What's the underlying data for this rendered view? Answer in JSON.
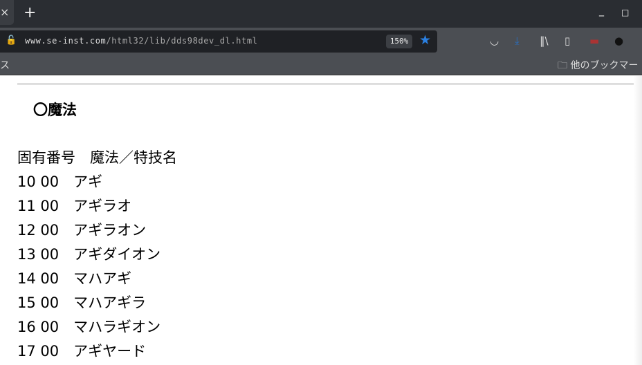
{
  "browser": {
    "tab_close": "×",
    "new_tab": "+",
    "minimize": "_",
    "maximize": "□",
    "url_host": "www.se-inst.com",
    "url_path": "/html32/lib/dds98dev_dl.html",
    "zoom": "150%",
    "bookmark_left": "ス",
    "bookmark_other": "他のブックマー"
  },
  "page": {
    "heading": "〇魔法",
    "header": "固有番号　魔法／特技名",
    "rows": [
      "10 00　アギ",
      "11 00　アギラオ",
      "12 00　アギラオン",
      "13 00　アギダイオン",
      "14 00　マハアギ",
      "15 00　マハアギラ",
      "16 00　マハラギオン",
      "17 00　アギヤード"
    ]
  }
}
